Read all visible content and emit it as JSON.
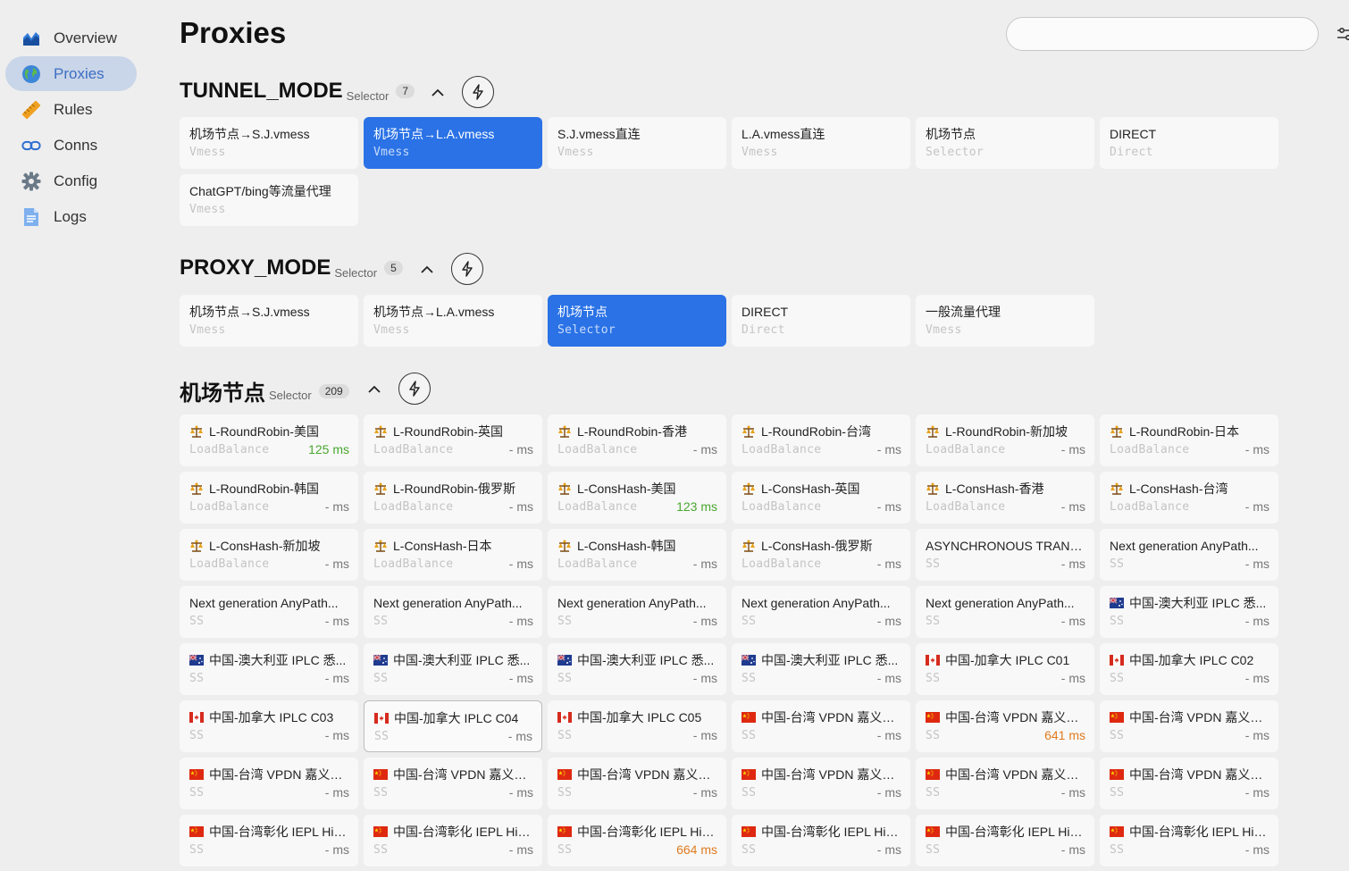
{
  "sidebar": {
    "items": [
      {
        "label": "Overview",
        "icon": "chart-icon",
        "active": false
      },
      {
        "label": "Proxies",
        "icon": "globe-icon",
        "active": true
      },
      {
        "label": "Rules",
        "icon": "ruler-icon",
        "active": false
      },
      {
        "label": "Conns",
        "icon": "link-icon",
        "active": false
      },
      {
        "label": "Config",
        "icon": "gear-icon",
        "active": false
      },
      {
        "label": "Logs",
        "icon": "document-icon",
        "active": false
      }
    ]
  },
  "page": {
    "title": "Proxies",
    "search_placeholder": ""
  },
  "groups": [
    {
      "name": "TUNNEL_MODE",
      "type": "Selector",
      "count": "7",
      "proxies": [
        {
          "name": "机场节点→S.J.vmess",
          "type": "Vmess"
        },
        {
          "name": "机场节点→L.A.vmess",
          "type": "Vmess",
          "selected": true
        },
        {
          "name": "S.J.vmess直连",
          "type": "Vmess"
        },
        {
          "name": "L.A.vmess直连",
          "type": "Vmess"
        },
        {
          "name": "机场节点",
          "type": "Selector"
        },
        {
          "name": "DIRECT",
          "type": "Direct"
        },
        {
          "name": "ChatGPT/bing等流量代理",
          "type": "Vmess"
        }
      ]
    },
    {
      "name": "PROXY_MODE",
      "type": "Selector",
      "count": "5",
      "proxies": [
        {
          "name": "机场节点→S.J.vmess",
          "type": "Vmess"
        },
        {
          "name": "机场节点→L.A.vmess",
          "type": "Vmess"
        },
        {
          "name": "机场节点",
          "type": "Selector",
          "selected": true
        },
        {
          "name": "DIRECT",
          "type": "Direct"
        },
        {
          "name": "一般流量代理",
          "type": "Vmess"
        }
      ]
    },
    {
      "name": "机场节点",
      "type": "Selector",
      "count": "209",
      "proxies": [
        {
          "name": "L-RoundRobin-美国",
          "type": "LoadBalance",
          "delay": "125 ms",
          "status": "good",
          "icon": "scale-icon"
        },
        {
          "name": "L-RoundRobin-英国",
          "type": "LoadBalance",
          "delay": "- ms",
          "icon": "scale-icon"
        },
        {
          "name": "L-RoundRobin-香港",
          "type": "LoadBalance",
          "delay": "- ms",
          "icon": "scale-icon"
        },
        {
          "name": "L-RoundRobin-台湾",
          "type": "LoadBalance",
          "delay": "- ms",
          "icon": "scale-icon"
        },
        {
          "name": "L-RoundRobin-新加坡",
          "type": "LoadBalance",
          "delay": "- ms",
          "icon": "scale-icon"
        },
        {
          "name": "L-RoundRobin-日本",
          "type": "LoadBalance",
          "delay": "- ms",
          "icon": "scale-icon"
        },
        {
          "name": "L-RoundRobin-韩国",
          "type": "LoadBalance",
          "delay": "- ms",
          "icon": "scale-icon"
        },
        {
          "name": "L-RoundRobin-俄罗斯",
          "type": "LoadBalance",
          "delay": "- ms",
          "icon": "scale-icon"
        },
        {
          "name": "L-ConsHash-美国",
          "type": "LoadBalance",
          "delay": "123 ms",
          "status": "good",
          "icon": "scale-icon"
        },
        {
          "name": "L-ConsHash-英国",
          "type": "LoadBalance",
          "delay": "- ms",
          "icon": "scale-icon"
        },
        {
          "name": "L-ConsHash-香港",
          "type": "LoadBalance",
          "delay": "- ms",
          "icon": "scale-icon"
        },
        {
          "name": "L-ConsHash-台湾",
          "type": "LoadBalance",
          "delay": "- ms",
          "icon": "scale-icon"
        },
        {
          "name": "L-ConsHash-新加坡",
          "type": "LoadBalance",
          "delay": "- ms",
          "icon": "scale-icon"
        },
        {
          "name": "L-ConsHash-日本",
          "type": "LoadBalance",
          "delay": "- ms",
          "icon": "scale-icon"
        },
        {
          "name": "L-ConsHash-韩国",
          "type": "LoadBalance",
          "delay": "- ms",
          "icon": "scale-icon"
        },
        {
          "name": "L-ConsHash-俄罗斯",
          "type": "LoadBalance",
          "delay": "- ms",
          "icon": "scale-icon"
        },
        {
          "name": "ASYNCHRONOUS TRANS...",
          "type": "SS",
          "delay": "- ms"
        },
        {
          "name": "Next generation AnyPath...",
          "type": "SS",
          "delay": "- ms"
        },
        {
          "name": "Next generation AnyPath...",
          "type": "SS",
          "delay": "- ms"
        },
        {
          "name": "Next generation AnyPath...",
          "type": "SS",
          "delay": "- ms"
        },
        {
          "name": "Next generation AnyPath...",
          "type": "SS",
          "delay": "- ms"
        },
        {
          "name": "Next generation AnyPath...",
          "type": "SS",
          "delay": "- ms"
        },
        {
          "name": "Next generation AnyPath...",
          "type": "SS",
          "delay": "- ms"
        },
        {
          "name": "中国-澳大利亚 IPLC 悉...",
          "type": "SS",
          "delay": "- ms",
          "icon": "au-flag-icon"
        },
        {
          "name": "中国-澳大利亚 IPLC 悉...",
          "type": "SS",
          "delay": "- ms",
          "icon": "au-flag-icon"
        },
        {
          "name": "中国-澳大利亚 IPLC 悉...",
          "type": "SS",
          "delay": "- ms",
          "icon": "au-flag-icon"
        },
        {
          "name": "中国-澳大利亚 IPLC 悉...",
          "type": "SS",
          "delay": "- ms",
          "icon": "au-flag-icon"
        },
        {
          "name": "中国-澳大利亚 IPLC 悉...",
          "type": "SS",
          "delay": "- ms",
          "icon": "au-flag-icon"
        },
        {
          "name": "中国-加拿大 IPLC C01",
          "type": "SS",
          "delay": "- ms",
          "icon": "ca-flag-icon"
        },
        {
          "name": "中国-加拿大 IPLC C02",
          "type": "SS",
          "delay": "- ms",
          "icon": "ca-flag-icon"
        },
        {
          "name": "中国-加拿大 IPLC C03",
          "type": "SS",
          "delay": "- ms",
          "icon": "ca-flag-icon"
        },
        {
          "name": "中国-加拿大 IPLC C04",
          "type": "SS",
          "delay": "- ms",
          "icon": "ca-flag-icon",
          "outlined": true
        },
        {
          "name": "中国-加拿大 IPLC C05",
          "type": "SS",
          "delay": "- ms",
          "icon": "ca-flag-icon"
        },
        {
          "name": "中国-台湾 VPDN 嘉义游...",
          "type": "SS",
          "delay": "- ms",
          "icon": "cn-flag-icon"
        },
        {
          "name": "中国-台湾 VPDN 嘉义游...",
          "type": "SS",
          "delay": "641 ms",
          "status": "warn",
          "icon": "cn-flag-icon"
        },
        {
          "name": "中国-台湾 VPDN 嘉义游...",
          "type": "SS",
          "delay": "- ms",
          "icon": "cn-flag-icon"
        },
        {
          "name": "中国-台湾 VPDN 嘉义游...",
          "type": "SS",
          "delay": "- ms",
          "icon": "cn-flag-icon"
        },
        {
          "name": "中国-台湾 VPDN 嘉义游...",
          "type": "SS",
          "delay": "- ms",
          "icon": "cn-flag-icon"
        },
        {
          "name": "中国-台湾 VPDN 嘉义游...",
          "type": "SS",
          "delay": "- ms",
          "icon": "cn-flag-icon"
        },
        {
          "name": "中国-台湾 VPDN 嘉义游...",
          "type": "SS",
          "delay": "- ms",
          "icon": "cn-flag-icon"
        },
        {
          "name": "中国-台湾 VPDN 嘉义游...",
          "type": "SS",
          "delay": "- ms",
          "icon": "cn-flag-icon"
        },
        {
          "name": "中国-台湾 VPDN 嘉义游...",
          "type": "SS",
          "delay": "- ms",
          "icon": "cn-flag-icon"
        },
        {
          "name": "中国-台湾彰化 IEPL HiN...",
          "type": "SS",
          "delay": "- ms",
          "icon": "cn-flag-icon"
        },
        {
          "name": "中国-台湾彰化 IEPL HiN...",
          "type": "SS",
          "delay": "- ms",
          "icon": "cn-flag-icon"
        },
        {
          "name": "中国-台湾彰化 IEPL HiN...",
          "type": "SS",
          "delay": "664 ms",
          "status": "warn",
          "icon": "cn-flag-icon"
        },
        {
          "name": "中国-台湾彰化 IEPL HiN...",
          "type": "SS",
          "delay": "- ms",
          "icon": "cn-flag-icon"
        },
        {
          "name": "中国-台湾彰化 IEPL HiN...",
          "type": "SS",
          "delay": "- ms",
          "icon": "cn-flag-icon"
        },
        {
          "name": "中国-台湾彰化 IEPL HiN...",
          "type": "SS",
          "delay": "- ms",
          "icon": "cn-flag-icon"
        }
      ]
    }
  ]
}
